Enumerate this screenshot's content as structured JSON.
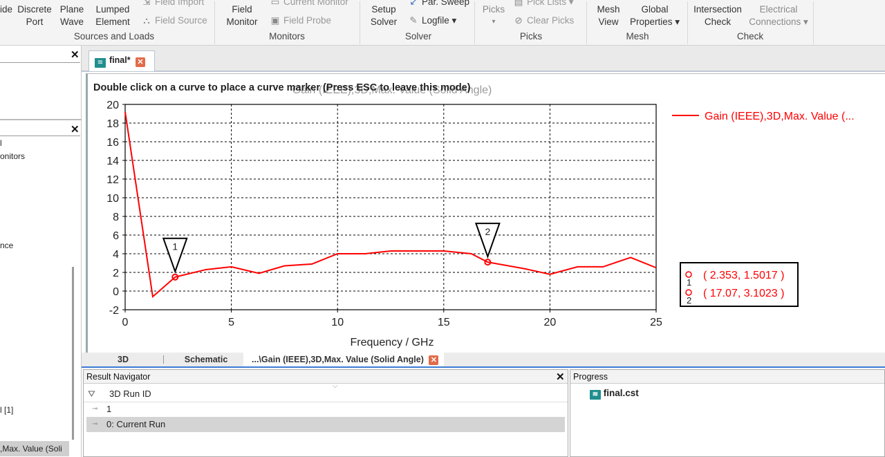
{
  "ribbon": {
    "items": [
      {
        "l1": "ide",
        "l2": "",
        "dim": false
      },
      {
        "l1": "Discrete",
        "l2": "Port",
        "dim": false
      },
      {
        "l1": "Plane",
        "l2": "Wave",
        "dim": false
      },
      {
        "l1": "Lumped",
        "l2": "Element",
        "dim": false
      },
      {
        "l1": "Field",
        "l2": "Monitor",
        "dim": false
      },
      {
        "l1": "Setup",
        "l2": "Solver",
        "dim": false
      },
      {
        "l1": "Picks",
        "l2": "",
        "dim": true
      },
      {
        "l1": "Mesh",
        "l2": "View",
        "dim": false
      },
      {
        "l1": "Global",
        "l2": "Properties ▾",
        "dim": false
      },
      {
        "l1": "Intersection",
        "l2": "Check",
        "dim": false
      },
      {
        "l1": "Electrical",
        "l2": "Connections ▾",
        "dim": true
      }
    ],
    "small": {
      "field_import": "Field Import",
      "field_source": "Field Source",
      "current_monitor": "Current Monitor",
      "field_probe": "Field Probe",
      "par_sweep": "Par. Sweep",
      "logfile": "Logfile ▾",
      "pick_lists": "Pick Lists ▾",
      "clear_picks": "Clear Picks"
    },
    "groups": {
      "sources": "Sources and Loads",
      "monitors": "Monitors",
      "solver": "Solver",
      "picks": "Picks",
      "mesh": "Mesh",
      "check": "Check"
    }
  },
  "left_panel": {
    "lines": [
      "l",
      "onitors",
      "nce",
      "l [1]",
      ",Max. Value (Soli"
    ]
  },
  "doc_tab": {
    "label": "final*"
  },
  "plot": {
    "instruction": "Double click on a curve to place a curve marker (Press ESC to leave this mode)",
    "chart_title": "Gain (IEEE),3D,Max. Value (Solid Angle)",
    "legend_label": "Gain (IEEE),3D,Max. Value (...",
    "marker_table": [
      {
        "id": "1",
        "text": "( 2.353, 1.5017 )"
      },
      {
        "id": "2",
        "text": "( 17.07, 3.1023 )"
      }
    ]
  },
  "chart_data": {
    "type": "line",
    "title": "Gain (IEEE),3D,Max. Value (Solid Angle)",
    "xlabel": "Frequency / GHz",
    "ylabel": "",
    "xlim": [
      0,
      25
    ],
    "ylim": [
      -2,
      20
    ],
    "xticks": [
      0,
      5,
      10,
      15,
      20,
      25
    ],
    "yticks": [
      -2,
      0,
      2,
      4,
      6,
      8,
      10,
      12,
      14,
      16,
      18,
      20
    ],
    "grid": true,
    "legend": "top-right",
    "color": "#ff0000",
    "series": [
      {
        "name": "Gain (IEEE),3D,Max. Value (...",
        "x": [
          0,
          1.3,
          2.353,
          3.8,
          5,
          6.3,
          7.5,
          8.8,
          10,
          11.3,
          12.5,
          13.8,
          15,
          16.3,
          17.07,
          18.8,
          20,
          21.3,
          22.5,
          23.8,
          25
        ],
        "y": [
          19.2,
          -0.6,
          1.5017,
          2.3,
          2.6,
          1.9,
          2.7,
          2.9,
          4.0,
          4.0,
          4.3,
          4.3,
          4.3,
          4.0,
          3.1023,
          2.4,
          1.8,
          2.6,
          2.6,
          3.6,
          2.5
        ]
      }
    ],
    "markers": [
      {
        "id": "1",
        "x": 2.353,
        "y": 1.5017
      },
      {
        "id": "2",
        "x": 17.07,
        "y": 3.1023
      }
    ]
  },
  "bottom_tabs": {
    "t3d": "3D",
    "schematic": "Schematic",
    "result": "...\\Gain (IEEE),3D,Max. Value (Solid Angle)"
  },
  "result_navigator": {
    "title": "Result Navigator",
    "column": "3D Run ID",
    "rows": [
      "1",
      "0: Current Run"
    ]
  },
  "progress": {
    "title": "Progress",
    "item": "final.cst"
  }
}
